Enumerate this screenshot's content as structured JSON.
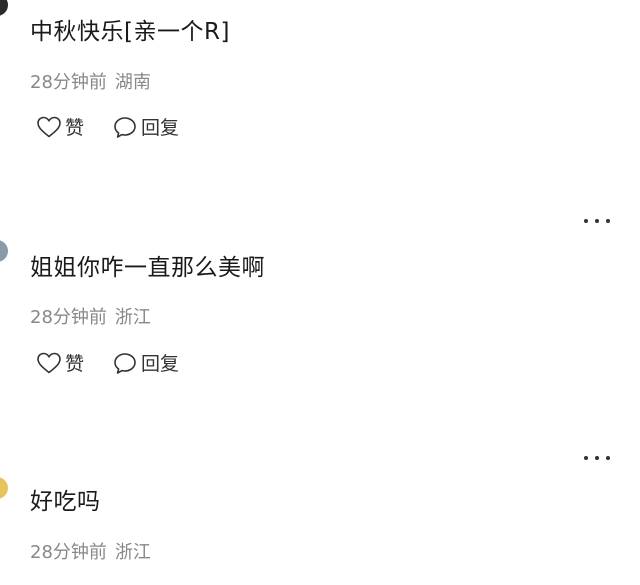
{
  "comments": [
    {
      "text": "中秋快乐[亲一个R]",
      "time": "28分钟前",
      "location": "湖南",
      "like_label": "赞",
      "reply_label": "回复"
    },
    {
      "text": "姐姐你咋一直那么美啊",
      "time": "28分钟前",
      "location": "浙江",
      "like_label": "赞",
      "reply_label": "回复"
    },
    {
      "text": "好吃吗",
      "time": "28分钟前",
      "location": "浙江"
    }
  ],
  "icons": {
    "like": "heart-outline-icon",
    "reply": "speech-bubble-icon",
    "more": "more-dots-icon"
  },
  "colors": {
    "text": "#1a1a1a",
    "meta": "#888888",
    "icon": "#333333",
    "avatar_1": "#2b2b2b",
    "avatar_2": "#8a9aa8",
    "avatar_3": "#e8c25a"
  }
}
